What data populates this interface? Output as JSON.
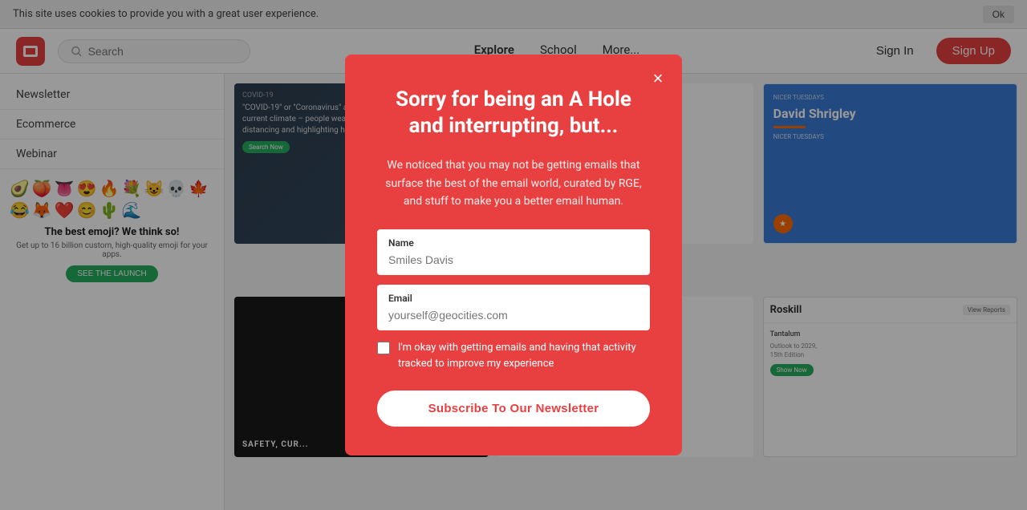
{
  "cookie_bar": {
    "text": "This site uses cookies to provide you with a great user experience.",
    "ok_label": "Ok"
  },
  "header": {
    "search_placeholder": "Search",
    "nav": {
      "explore": "Explore",
      "school": "School",
      "more": "More..."
    },
    "sign_in": "Sign In",
    "sign_up": "Sign Up"
  },
  "sidebar": {
    "items": [
      {
        "label": "Newsletter"
      },
      {
        "label": "Ecommerce"
      },
      {
        "label": "Webinar"
      }
    ]
  },
  "modal": {
    "title": "Sorry for being an A Hole and interrupting, but...",
    "body": "We noticed that you may not be getting emails that surface the best of the email world, curated by RGE, and stuff to make you a better email human.",
    "name_label": "Name",
    "name_placeholder": "Smiles Davis",
    "email_label": "Email",
    "email_placeholder": "yourself@geocities.com",
    "checkbox_label": "I'm okay with getting emails and having that activity tracked to improve my experience",
    "subscribe_button": "Subscribe To Our Newsletter",
    "close_label": "×"
  },
  "sidebar_card": {
    "emoji": [
      "🥑",
      "🍑",
      "👅",
      "😍",
      "🔥",
      "💐",
      "😺",
      "💀",
      "🍁",
      "😂",
      "🦊",
      "❤️",
      "😊",
      "🌵",
      "🌊"
    ],
    "title": "The best emoji? We think so!",
    "subtitle": "Get up to 16 billion custom, high-quality emoji for your apps.",
    "launch_btn": "SEE THE LAUNCH"
  },
  "content_cards": [
    {
      "id": "card-covid",
      "type": "dark"
    },
    {
      "id": "card-package",
      "type": "light"
    },
    {
      "id": "card-david",
      "type": "blue"
    },
    {
      "id": "card-distancing",
      "type": "dark2"
    },
    {
      "id": "card-delivery",
      "type": "light2"
    },
    {
      "id": "card-nicer",
      "type": "blue2"
    }
  ]
}
